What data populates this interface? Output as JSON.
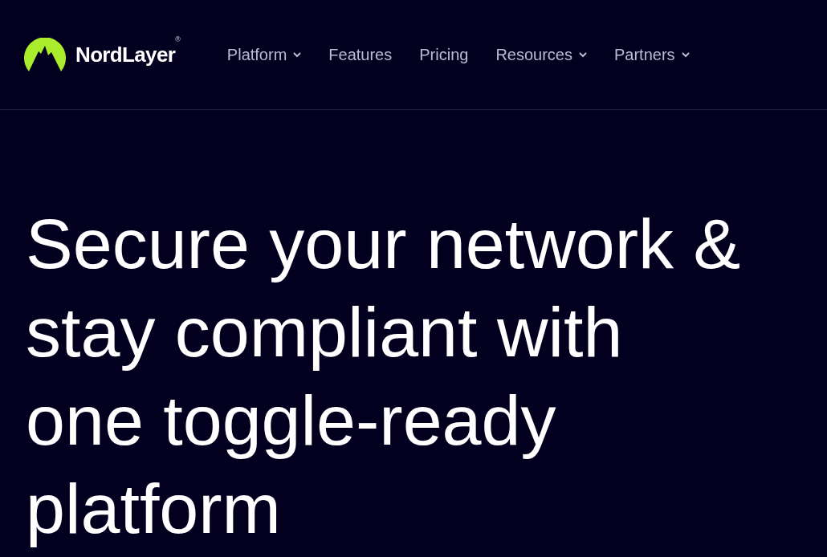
{
  "logo": {
    "wordmark": "NordLayer",
    "mark": "®"
  },
  "nav": [
    {
      "label": "Platform",
      "has_menu": true
    },
    {
      "label": "Features",
      "has_menu": false
    },
    {
      "label": "Pricing",
      "has_menu": false
    },
    {
      "label": "Resources",
      "has_menu": true
    },
    {
      "label": "Partners",
      "has_menu": true
    }
  ],
  "hero": {
    "headline_lines": [
      "Secure your network &",
      "stay compliant with",
      "one toggle-ready",
      "platform"
    ]
  }
}
